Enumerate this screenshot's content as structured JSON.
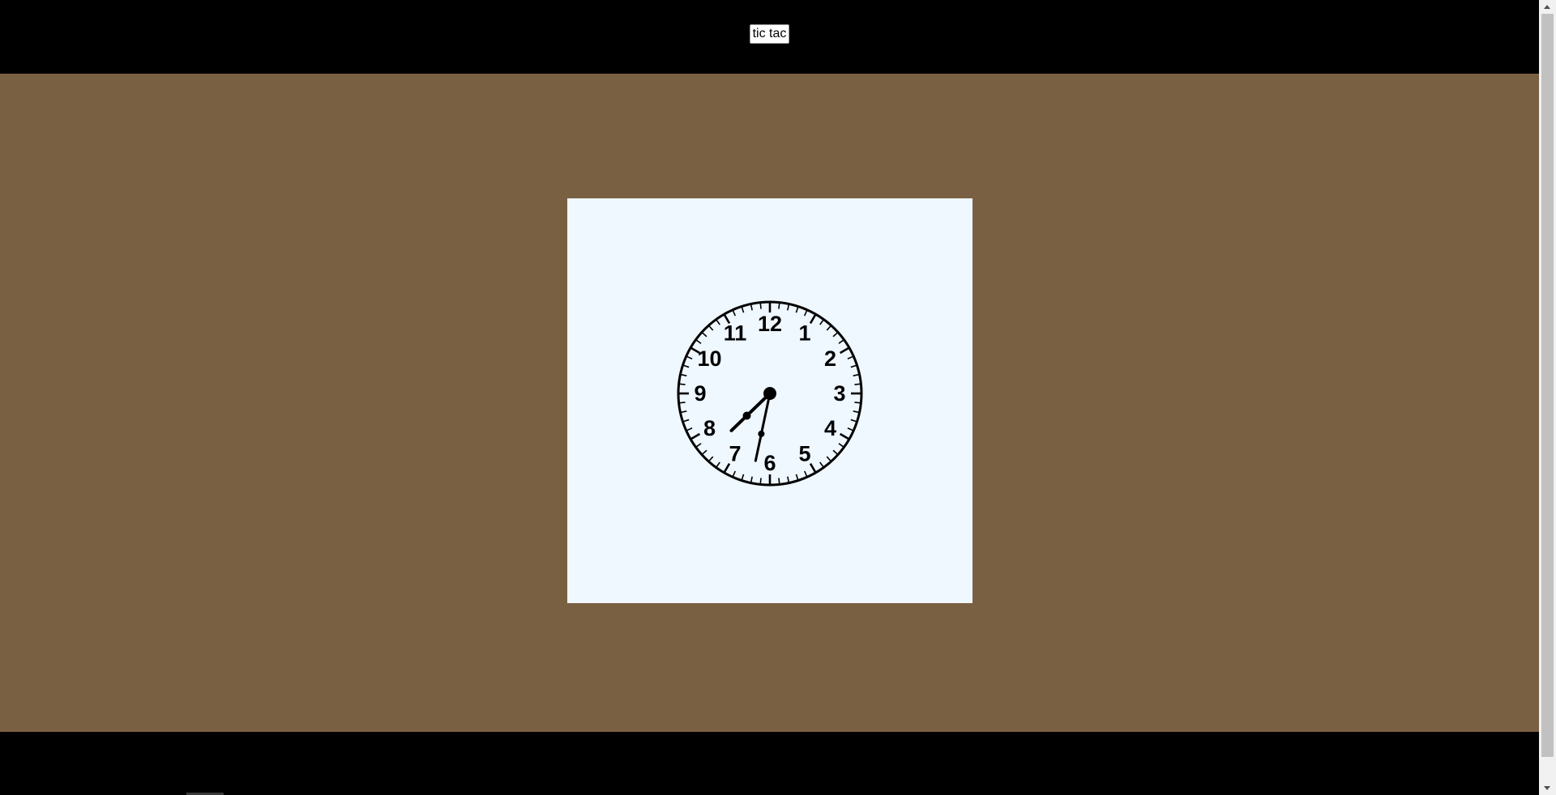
{
  "header": {
    "button_label": "tic tac"
  },
  "clock": {
    "numerals": [
      "12",
      "1",
      "2",
      "3",
      "4",
      "5",
      "6",
      "7",
      "8",
      "9",
      "10",
      "11"
    ],
    "time": {
      "hours": 7,
      "minutes": 32
    },
    "face_color": "#eff7ff",
    "ink_color": "#000000"
  },
  "colors": {
    "bar": "#000000",
    "stage": "#7a6042",
    "card": "#eff7ff"
  },
  "scrollbar": {
    "up_icon": "scroll-up-arrow-icon",
    "down_icon": "scroll-down-arrow-icon"
  }
}
